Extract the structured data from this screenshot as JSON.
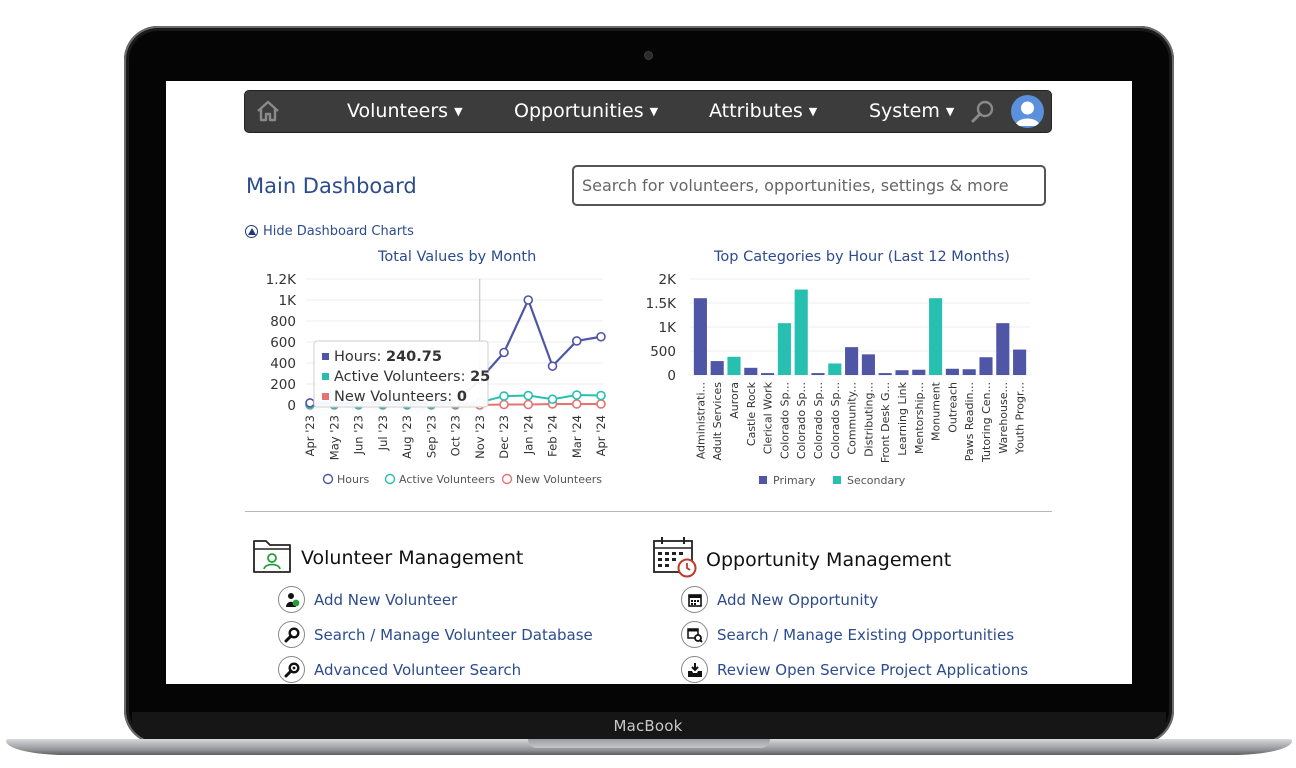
{
  "device": {
    "brand": "MacBook"
  },
  "nav": {
    "items": [
      {
        "label": "Volunteers"
      },
      {
        "label": "Opportunities"
      },
      {
        "label": "Attributes"
      },
      {
        "label": "System"
      }
    ]
  },
  "page": {
    "title": "Main Dashboard",
    "search_placeholder": "Search for volunteers, opportunities, settings & more",
    "hide_charts_label": "Hide Dashboard Charts"
  },
  "chart_data": [
    {
      "type": "line",
      "title": "Total Values by Month",
      "categories": [
        "Apr '23",
        "May '23",
        "Jun '23",
        "Jul '23",
        "Aug '23",
        "Sep '23",
        "Oct '23",
        "Nov '23",
        "Dec '23",
        "Jan '24",
        "Feb '24",
        "Mar '24",
        "Apr '24"
      ],
      "ylim": [
        0,
        1200
      ],
      "yticks": [
        "0",
        "200",
        "400",
        "600",
        "800",
        "1K",
        "1.2K"
      ],
      "series": [
        {
          "name": "Hours",
          "color": "#4f56a6",
          "values": [
            20,
            20,
            20,
            20,
            20,
            20,
            20,
            240.75,
            500,
            1000,
            370,
            610,
            650
          ]
        },
        {
          "name": "Active Volunteers",
          "color": "#26bfb0",
          "values": [
            5,
            5,
            5,
            5,
            5,
            5,
            10,
            25,
            85,
            90,
            55,
            95,
            90
          ]
        },
        {
          "name": "New Volunteers",
          "color": "#e57373",
          "values": [
            0,
            0,
            0,
            0,
            0,
            0,
            0,
            0,
            5,
            5,
            10,
            10,
            10
          ]
        }
      ],
      "tooltip": {
        "rows": [
          {
            "label": "Hours: ",
            "value": "240.75",
            "color": "#4f56a6"
          },
          {
            "label": "Active Volunteers: ",
            "value": "25",
            "color": "#26bfb0"
          },
          {
            "label": "New Volunteers: ",
            "value": "0",
            "color": "#e57373"
          }
        ]
      }
    },
    {
      "type": "bar",
      "title": "Top Categories by Hour (Last 12 Months)",
      "categories": [
        "Administrati...",
        "Adult Services",
        "Aurora",
        "Castle Rock",
        "Clerical Work",
        "Colorado Sp...",
        "Colorado Sp...",
        "Colorado Sp...",
        "Colorado Sp...",
        "Community...",
        "Distributing...",
        "Front Desk G...",
        "Learning Link",
        "Mentorship...",
        "Monument",
        "Outreach",
        "Paws Readin...",
        "Tutoring Cen...",
        "Warehouse...",
        "Youth Progr..."
      ],
      "values": [
        1600,
        290,
        380,
        150,
        40,
        1080,
        1780,
        40,
        240,
        580,
        430,
        40,
        100,
        110,
        1600,
        130,
        120,
        370,
        1080,
        530
      ],
      "series_index": [
        0,
        0,
        1,
        0,
        0,
        1,
        1,
        0,
        1,
        0,
        0,
        0,
        0,
        0,
        1,
        0,
        0,
        0,
        0,
        0
      ],
      "legend": [
        {
          "name": "Primary",
          "color": "#4f56a6"
        },
        {
          "name": "Secondary",
          "color": "#26bfb0"
        }
      ],
      "ylim": [
        0,
        2000
      ],
      "yticks": [
        "0",
        "500",
        "1K",
        "1.5K",
        "2K"
      ]
    }
  ],
  "volunteer_mgmt": {
    "title": "Volunteer Management",
    "links": [
      {
        "label": "Add New Volunteer"
      },
      {
        "label": "Search / Manage Volunteer Database"
      },
      {
        "label": "Advanced Volunteer Search"
      }
    ]
  },
  "opportunity_mgmt": {
    "title": "Opportunity Management",
    "links": [
      {
        "label": "Add New Opportunity"
      },
      {
        "label": "Search / Manage Existing Opportunities"
      },
      {
        "label": "Review Open Service Project Applications"
      }
    ]
  }
}
